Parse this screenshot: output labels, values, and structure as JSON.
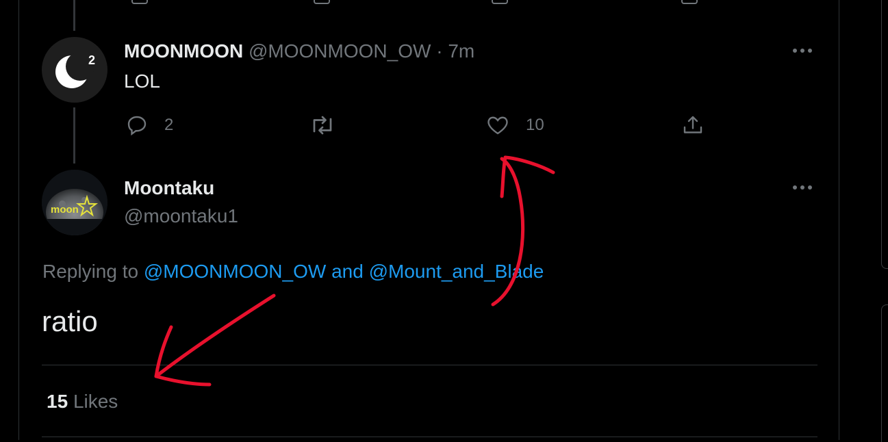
{
  "reply_tweet": {
    "display_name": "MOONMOON",
    "handle": "@MOONMOON_OW",
    "separator": "·",
    "time": "7m",
    "text": "LOL",
    "reply_count": "2",
    "retweet_count": "",
    "like_count": "10"
  },
  "main_tweet": {
    "display_name": "Moontaku",
    "handle": "@moontaku1",
    "replying_prefix": "Replying to",
    "replying_user_1": "@MOONMOON_OW",
    "replying_and": "and",
    "replying_user_2": "@Mount_and_Blade",
    "text": "ratio",
    "likes_count": "15",
    "likes_label": "Likes"
  },
  "avatar_moon": {
    "badge": "2"
  },
  "avatar_taku": {
    "label": "moon"
  },
  "colors": {
    "background": "#000000",
    "text": "#e7e9ea",
    "muted": "#71767b",
    "link": "#1d9bf0",
    "annotation": "#e8112d"
  },
  "icons": [
    "reply-icon",
    "retweet-icon",
    "like-icon",
    "share-icon",
    "more-icon"
  ]
}
